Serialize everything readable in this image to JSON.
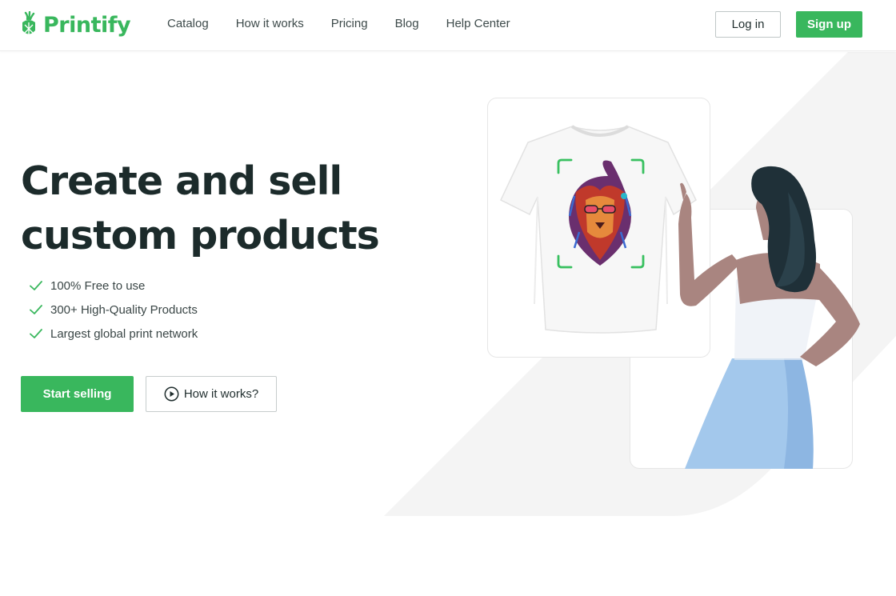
{
  "brand": {
    "name": "Printify",
    "color": "#39b75d"
  },
  "nav": {
    "items": [
      {
        "label": "Catalog"
      },
      {
        "label": "How it works"
      },
      {
        "label": "Pricing"
      },
      {
        "label": "Blog"
      },
      {
        "label": "Help Center"
      }
    ],
    "login_label": "Log in",
    "signup_label": "Sign up"
  },
  "hero": {
    "title_line1": "Create and sell",
    "title_line2": "custom products",
    "features": [
      "100% Free to use",
      "300+ High-Quality Products",
      "Largest global print network"
    ],
    "cta_primary": "Start selling",
    "cta_secondary": "How it works?"
  },
  "icons": {
    "logo": "pineapple-logo-icon",
    "feature": "checkmark-icon",
    "play": "play-circle-icon"
  },
  "colors": {
    "accent": "#39b75d",
    "text_dark": "#1c2b2b",
    "skirt": "#9cc4ea",
    "hair": "#1f3038",
    "skin": "#a98580"
  }
}
